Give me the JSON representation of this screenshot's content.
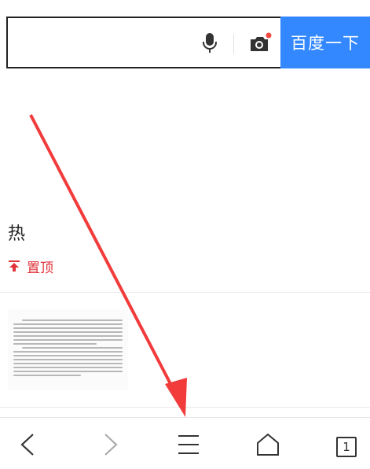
{
  "search": {
    "value": "",
    "placeholder": "",
    "button_label": "百度一下"
  },
  "feed": {
    "hot_label": "热",
    "pin_label": "置顶"
  },
  "tabs": {
    "count": "1"
  },
  "colors": {
    "accent": "#3388ff",
    "pin_red": "#e0333a",
    "arrow_red": "#f23b3b"
  },
  "icons": {
    "mic": "microphone-icon",
    "camera": "camera-icon",
    "pin": "pin-top-icon",
    "back": "back-arrow-icon",
    "forward": "forward-arrow-icon",
    "menu": "menu-icon",
    "home": "home-icon",
    "tabs": "tabs-icon"
  }
}
